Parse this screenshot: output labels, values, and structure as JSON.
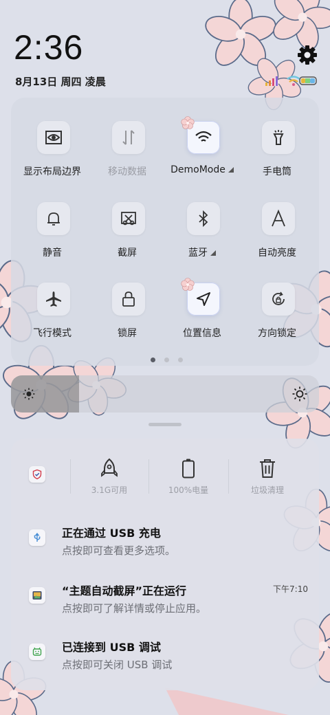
{
  "status_bar": {
    "time": "2:36",
    "date": "8月13日 周四 凌晨",
    "icons": [
      "signal-icon",
      "wifi-icon",
      "battery-icon"
    ]
  },
  "quick_settings": {
    "tiles": [
      {
        "label": "显示布局边界",
        "icon": "eye-frame-icon",
        "state": "normal"
      },
      {
        "label": "移动数据",
        "icon": "mobile-data-icon",
        "state": "disabled"
      },
      {
        "label": "DemoMode",
        "icon": "wifi-icon",
        "state": "on",
        "expandable": true
      },
      {
        "label": "手电筒",
        "icon": "flashlight-icon",
        "state": "normal"
      },
      {
        "label": "静音",
        "icon": "bell-icon",
        "state": "normal"
      },
      {
        "label": "截屏",
        "icon": "screenshot-icon",
        "state": "normal"
      },
      {
        "label": "蓝牙",
        "icon": "bluetooth-icon",
        "state": "normal",
        "expandable": true
      },
      {
        "label": "自动亮度",
        "icon": "auto-brightness-icon",
        "state": "normal"
      },
      {
        "label": "飞行模式",
        "icon": "airplane-icon",
        "state": "normal"
      },
      {
        "label": "锁屏",
        "icon": "lock-icon",
        "state": "normal"
      },
      {
        "label": "位置信息",
        "icon": "location-icon",
        "state": "on"
      },
      {
        "label": "方向锁定",
        "icon": "rotation-lock-icon",
        "state": "normal"
      }
    ],
    "page_count": 3,
    "current_page": 1
  },
  "brightness": {
    "level": 0.22
  },
  "cleaner": {
    "memory_label": "3.1G可用",
    "battery_label": "100%电量",
    "trash_label": "垃圾清理"
  },
  "notifications": [
    {
      "icon": "usb-icon",
      "title": "正在通过 USB 充电",
      "text": "点按即可查看更多选项。",
      "time": ""
    },
    {
      "icon": "screenshot-app-icon",
      "title": "“主题自动截屏”正在运行",
      "text": "点按即可了解详情或停止应用。",
      "time": "下午7:10"
    },
    {
      "icon": "android-debug-icon",
      "title": "已连接到 USB 调试",
      "text": "点按即可关闭 USB 调试",
      "time": ""
    }
  ],
  "colors": {
    "accent": "#4a5fc1",
    "panel": "#d6dae4",
    "petal": "#f3d3d3"
  }
}
